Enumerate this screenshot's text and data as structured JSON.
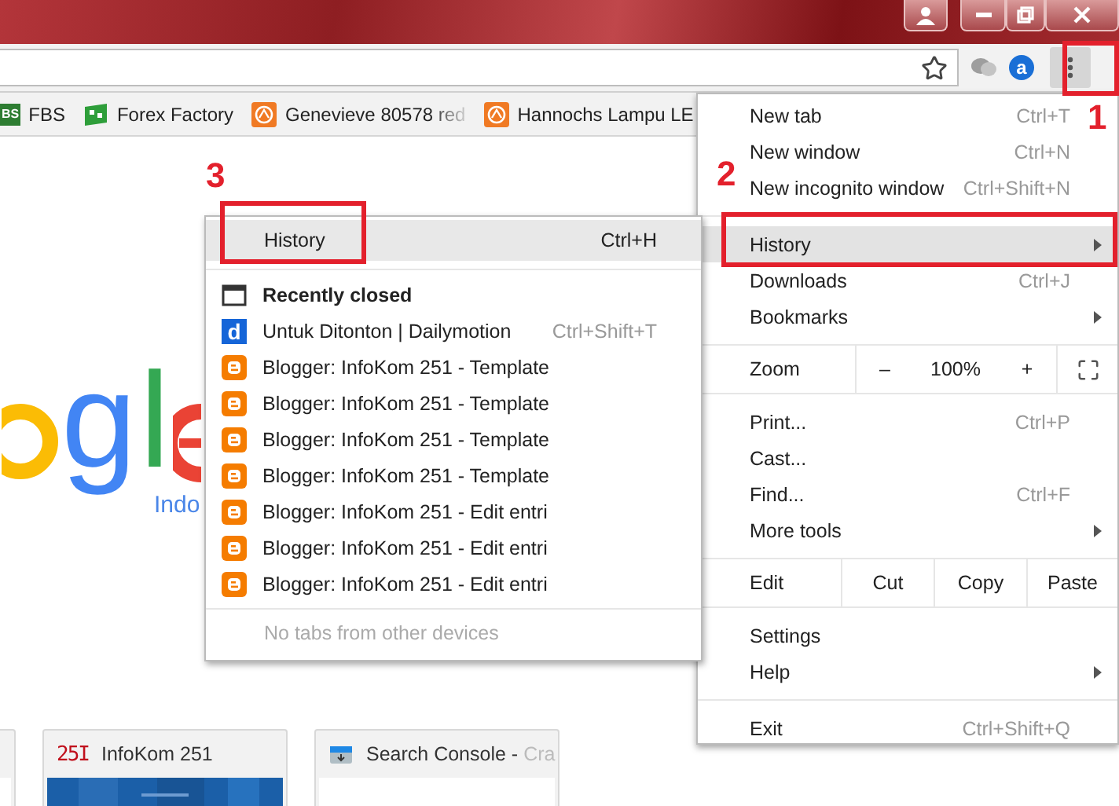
{
  "toolbar": {
    "extensions": [
      {
        "kind": "cloud"
      },
      {
        "kind": "letter",
        "text": "a"
      }
    ]
  },
  "bookmarks": [
    {
      "label": "FBS",
      "kind": "fbs",
      "badge": "BS",
      "faded": false
    },
    {
      "label": "Forex Factory",
      "kind": "forex",
      "faded": false
    },
    {
      "label": "Genevieve 80578 red",
      "kind": "orange",
      "faded": true
    },
    {
      "label": "Hannochs Lampu LE",
      "kind": "orange",
      "faded": false
    }
  ],
  "page": {
    "logo": "gl",
    "logo_sub": "Indo",
    "tiles": [
      {
        "kind": "partial"
      },
      {
        "kind": "infokom",
        "badge": "25I",
        "title": "InfoKom 251"
      },
      {
        "kind": "console",
        "title": "Search Console - ",
        "title_faded": "Cra"
      }
    ]
  },
  "menu": {
    "sections": [
      [
        {
          "kind": "item",
          "label": "New tab",
          "shortcut": "Ctrl+T",
          "submenu": false,
          "selected": false
        },
        {
          "kind": "item",
          "label": "New window",
          "shortcut": "Ctrl+N",
          "submenu": false,
          "selected": false
        },
        {
          "kind": "item",
          "label": "New incognito window",
          "shortcut": "Ctrl+Shift+N",
          "submenu": false,
          "selected": false
        }
      ],
      [
        {
          "kind": "item",
          "label": "History",
          "submenu": true,
          "selected": true
        },
        {
          "kind": "item",
          "label": "Downloads",
          "shortcut": "Ctrl+J",
          "submenu": false,
          "selected": false
        },
        {
          "kind": "item",
          "label": "Bookmarks",
          "submenu": true,
          "selected": false
        }
      ],
      [
        {
          "kind": "zoom",
          "label": "Zoom",
          "minus": "–",
          "value": "100%",
          "plus": "+"
        }
      ],
      [
        {
          "kind": "item",
          "label": "Print...",
          "shortcut": "Ctrl+P",
          "submenu": false,
          "selected": false
        },
        {
          "kind": "item",
          "label": "Cast...",
          "submenu": false,
          "selected": false
        },
        {
          "kind": "item",
          "label": "Find...",
          "shortcut": "Ctrl+F",
          "submenu": false,
          "selected": false
        },
        {
          "kind": "item",
          "label": "More tools",
          "submenu": true,
          "selected": false
        }
      ],
      [
        {
          "kind": "edit",
          "label": "Edit",
          "actions": [
            "Cut",
            "Copy",
            "Paste"
          ]
        }
      ],
      [
        {
          "kind": "item",
          "label": "Settings",
          "submenu": false,
          "selected": false
        },
        {
          "kind": "item",
          "label": "Help",
          "submenu": true,
          "selected": false
        }
      ],
      [
        {
          "kind": "item",
          "label": "Exit",
          "shortcut": "Ctrl+Shift+Q",
          "submenu": false,
          "selected": false
        }
      ]
    ]
  },
  "history_menu": {
    "header": {
      "label": "History",
      "shortcut": "Ctrl+H",
      "selected": true
    },
    "recent_title": "Recently closed",
    "entries": [
      {
        "kind": "dailymotion",
        "badge": "d",
        "label": "Untuk Ditonton | Dailymotion",
        "shortcut": "Ctrl+Shift+T"
      },
      {
        "kind": "blogger",
        "label": "Blogger: InfoKom 251 - Template"
      },
      {
        "kind": "blogger",
        "label": "Blogger: InfoKom 251 - Template"
      },
      {
        "kind": "blogger",
        "label": "Blogger: InfoKom 251 - Template"
      },
      {
        "kind": "blogger",
        "label": "Blogger: InfoKom 251 - Template"
      },
      {
        "kind": "blogger",
        "label": "Blogger: InfoKom 251 - Edit entri"
      },
      {
        "kind": "blogger",
        "label": "Blogger: InfoKom 251 - Edit entri"
      },
      {
        "kind": "blogger",
        "label": "Blogger: InfoKom 251 - Edit entri"
      }
    ],
    "footer": "No tabs from other devices"
  },
  "annotations": [
    {
      "number": "1"
    },
    {
      "number": "2"
    },
    {
      "number": "3"
    }
  ]
}
